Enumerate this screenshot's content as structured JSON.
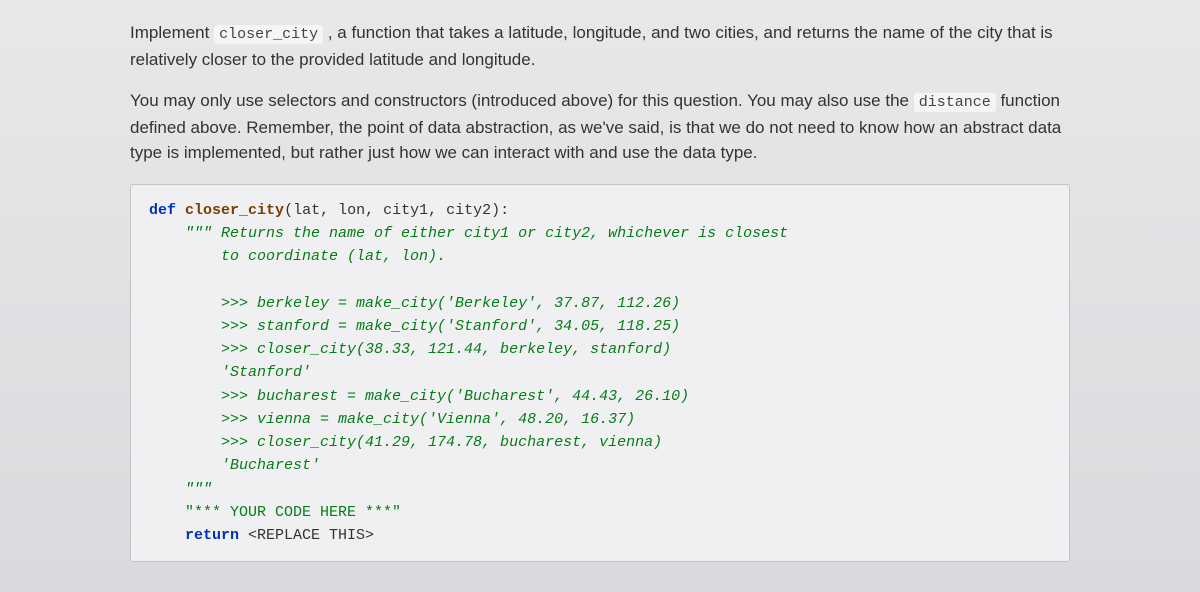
{
  "para1_pre": "Implement ",
  "para1_code": "closer_city",
  "para1_post": " , a function that takes a latitude, longitude, and two cities, and returns the name of the city that is relatively closer to the provided latitude and longitude.",
  "para2_pre": "You may only use selectors and constructors (introduced above) for this question. You may also use the ",
  "para2_code": "distance",
  "para2_post": " function defined above. Remember, the point of data abstraction, as we've said, is that we do not need to know how an abstract data type is implemented, but rather just how we can interact with and use the data type.",
  "code": {
    "def_kw": "def",
    "def_fn": "closer_city",
    "def_params": "(lat, lon, city1, city2):",
    "doc1": "\"\"\" Returns the name of either city1 or city2, whichever is closest",
    "doc2": "    to coordinate (lat, lon).",
    "ex1": ">>> berkeley = make_city('Berkeley', 37.87, 112.26)",
    "ex2": ">>> stanford = make_city('Stanford', 34.05, 118.25)",
    "ex3": ">>> closer_city(38.33, 121.44, berkeley, stanford)",
    "ex3r": "'Stanford'",
    "ex4": ">>> bucharest = make_city('Bucharest', 44.43, 26.10)",
    "ex5": ">>> vienna = make_city('Vienna', 48.20, 16.37)",
    "ex6": ">>> closer_city(41.29, 174.78, bucharest, vienna)",
    "ex6r": "'Bucharest'",
    "doc_end": "\"\"\"",
    "placeholder": "\"*** YOUR CODE HERE ***\"",
    "ret_kw": "return",
    "ret_val": " <REPLACE THIS>"
  }
}
